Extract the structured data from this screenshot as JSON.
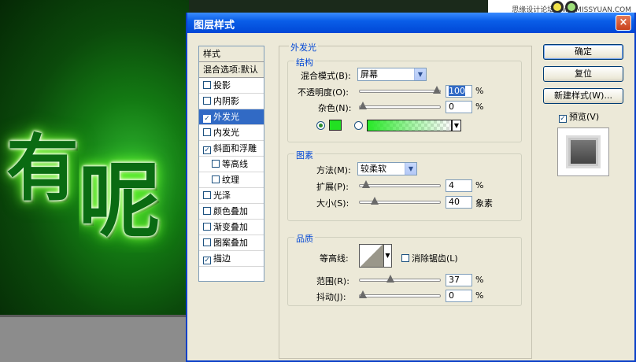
{
  "canvas": {
    "char1": "有",
    "char2": "呢"
  },
  "watermark": "思缘设计论坛 www.MISSYUAN.COM",
  "dialog": {
    "title": "图层样式",
    "close": "×"
  },
  "styles_list": [
    {
      "label": "样式",
      "type": "header"
    },
    {
      "label": "混合选项:默认",
      "type": "header"
    },
    {
      "label": "投影",
      "checked": false
    },
    {
      "label": "内阴影",
      "checked": false
    },
    {
      "label": "外发光",
      "checked": true,
      "selected": true
    },
    {
      "label": "内发光",
      "checked": false
    },
    {
      "label": "斜面和浮雕",
      "checked": true
    },
    {
      "label": "等高线",
      "checked": false,
      "sub": true
    },
    {
      "label": "纹理",
      "checked": false,
      "sub": true
    },
    {
      "label": "光泽",
      "checked": false
    },
    {
      "label": "颜色叠加",
      "checked": false
    },
    {
      "label": "渐变叠加",
      "checked": false
    },
    {
      "label": "图案叠加",
      "checked": false
    },
    {
      "label": "描边",
      "checked": true
    }
  ],
  "panel": {
    "title": "外发光",
    "structure": {
      "title": "结构",
      "blend_mode_label": "混合模式(B):",
      "blend_mode_value": "屏幕",
      "opacity_label": "不透明度(O):",
      "opacity_value": "100",
      "opacity_pct": 100,
      "noise_label": "杂色(N):",
      "noise_value": "0",
      "noise_pct": 0,
      "unit": "%"
    },
    "elements": {
      "title": "图素",
      "technique_label": "方法(M):",
      "technique_value": "较柔软",
      "spread_label": "扩展(P):",
      "spread_value": "4",
      "spread_pct": 4,
      "size_label": "大小(S):",
      "size_value": "40",
      "size_pct": 16,
      "unit_pct": "%",
      "unit_px": "象素"
    },
    "quality": {
      "title": "品质",
      "contour_label": "等高线:",
      "antialias_label": "消除锯齿(L)",
      "range_label": "范围(R):",
      "range_value": "37",
      "range_pct": 37,
      "jitter_label": "抖动(J):",
      "jitter_value": "0",
      "jitter_pct": 0,
      "unit": "%"
    },
    "glow_color": "#22e022"
  },
  "buttons": {
    "ok": "确定",
    "reset": "复位",
    "new_style": "新建样式(W)...",
    "preview": "预览(V)"
  }
}
